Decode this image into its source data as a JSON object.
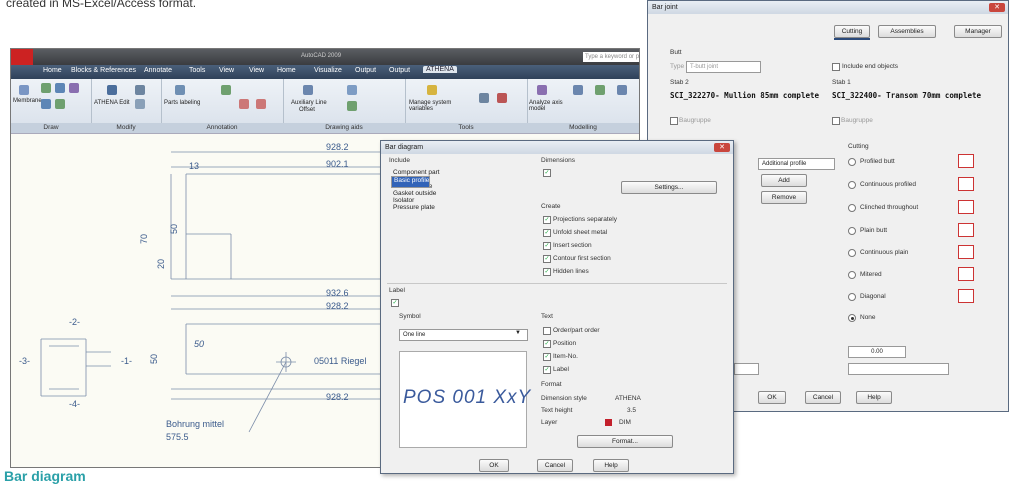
{
  "top_text": "created in MS-Excel/Access format.",
  "bottom_caption": "Bar diagram",
  "cad": {
    "app_title": "AutoCAD 2009",
    "search_placeholder": "Type a keyword or phrase",
    "tabs": [
      "Home",
      "Blocks & References",
      "Annotate",
      "Tools",
      "View",
      "View",
      "Home",
      "Visualize",
      "Output",
      "Output",
      "ATHENA"
    ],
    "active_tab": "ATHENA",
    "panels": [
      {
        "label": "Draw",
        "items": [
          "Membrane"
        ]
      },
      {
        "label": "Modify",
        "items": [
          "ATHENA Edit"
        ]
      },
      {
        "label": "Annotation",
        "items": [
          "Parts labeling"
        ]
      },
      {
        "label": "Drawing aids",
        "items": [
          "Auxiliary Line",
          "Offset"
        ]
      },
      {
        "label": "Tools",
        "items": [
          "Manage system variables"
        ]
      },
      {
        "label": "Modelling",
        "items": [
          "Analyze axis model"
        ]
      }
    ],
    "dims": [
      "928.2",
      "902.1",
      "13",
      "50",
      "70",
      "20",
      "932.6",
      "928.2",
      "50",
      "50",
      "05011 Riegel",
      "928.2",
      "Bohrung mittel",
      "575.5",
      "-2-",
      "-3-",
      "-1-",
      "-4-"
    ]
  },
  "bar_joint": {
    "title": "Bar joint",
    "tabs": [
      "Cutting",
      "Assemblies",
      "Manager"
    ],
    "butt_label": "Butt",
    "type_label": "Type",
    "type_value": "T-butt joint",
    "include_end_objects": "Include end objects",
    "stab2_label": "Stab 2",
    "stab2_text": "SCI_322270- Mullion 85mm complete",
    "stab1_label": "Stab 1",
    "stab1_text": "SCI_322400- Transom 70mm complete",
    "baugruppe": "Baugruppe",
    "additional_profile": "Additional profile",
    "add": "Add",
    "remove": "Remove",
    "cutting_label": "Cutting",
    "cutting_options": [
      "Profiled butt",
      "Continuous profiled",
      "Clinched throughout",
      "Plain butt",
      "Continuous plain",
      "Mitered",
      "Diagonal",
      "None"
    ],
    "cutting_selected": "None",
    "value": "0.00",
    "ok": "OK",
    "cancel": "Cancel",
    "help": "Help"
  },
  "bar_diagram": {
    "title": "Bar diagram",
    "include_label": "Include",
    "include_items": [
      "Component part",
      "Basic profile",
      "Cover",
      "Gasket inside",
      "Gasket outside",
      "Isolator",
      "Pressure plate"
    ],
    "include_selected": "Basic profile",
    "dimensions_label": "Dimensions",
    "settings_button": "Settings...",
    "create_label": "Create",
    "create_items": [
      "Projections separately",
      "Unfold sheet metal",
      "Insert section",
      "Contour first section",
      "Hidden lines"
    ],
    "label_label": "Label",
    "symbol_label": "Symbol",
    "symbol_value": "One line",
    "preview_text": "POS 001 XxY",
    "text_label": "Text",
    "text_items": [
      {
        "label": "Order/part order",
        "checked": false
      },
      {
        "label": "Position",
        "checked": true
      },
      {
        "label": "Item-No.",
        "checked": true
      },
      {
        "label": "Label",
        "checked": true
      }
    ],
    "format_label": "Format",
    "dimension_style_label": "Dimension style",
    "dimension_style_value": "ATHENA",
    "text_height_label": "Text height",
    "text_height_value": "3.5",
    "layer_label": "Layer",
    "layer_value": "DIM",
    "format_button": "Format...",
    "ok": "OK",
    "cancel": "Cancel",
    "help": "Help"
  }
}
